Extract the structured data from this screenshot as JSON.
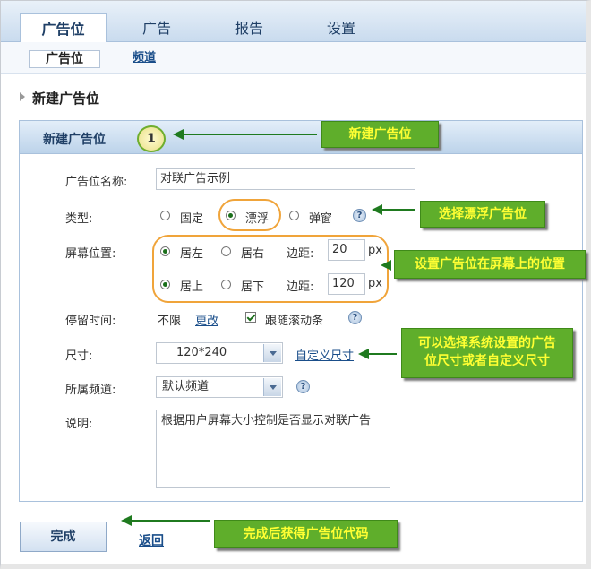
{
  "tabs": [
    "广告位",
    "广告",
    "报告",
    "设置"
  ],
  "subtabs": [
    "广告位",
    "频道"
  ],
  "page_title": "新建广告位",
  "panel_title": "新建广告位",
  "step_number": "1",
  "form": {
    "name_label": "广告位名称:",
    "name_value": "对联广告示例",
    "type_label": "类型:",
    "type_options": [
      "固定",
      "漂浮",
      "弹窗"
    ],
    "position_label": "屏幕位置:",
    "h_options": [
      "居左",
      "居右"
    ],
    "margin_label": "边距:",
    "h_margin": "20",
    "v_options": [
      "居上",
      "居下"
    ],
    "v_margin": "120",
    "unit": "px",
    "stay_label": "停留时间:",
    "stay_value": "不限",
    "change_link": "更改",
    "follow_scroll": "跟随滚动条",
    "size_label": "尺寸:",
    "size_value": "120*240",
    "custom_size_link": "自定义尺寸",
    "channel_label": "所属频道:",
    "channel_value": "默认频道",
    "desc_label": "说明:",
    "desc_value": "根据用户屏幕大小控制是否显示对联广告"
  },
  "callouts": {
    "new_slot": "新建广告位",
    "choose_float": "选择漂浮广告位",
    "set_position": "设置广告位在屏幕上的位置",
    "size_line1": "可以选择系统设置的广告",
    "size_line2": "位尺寸或者自定义尺寸",
    "finish": "完成后获得广告位代码"
  },
  "actions": {
    "finish_button": "完成",
    "back_link": "返回"
  },
  "help_glyph": "?",
  "colors": {
    "callout_bg": "#5fae2b",
    "callout_text": "#ffff33",
    "arrow": "#1f7a1f",
    "highlight_oval": "#f0a43a"
  }
}
